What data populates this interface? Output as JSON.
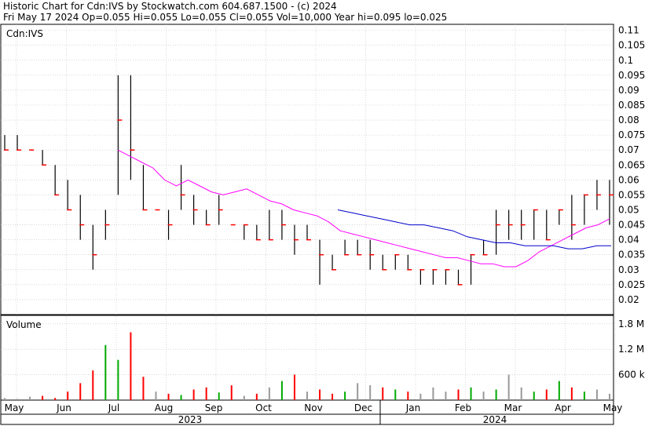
{
  "header": {
    "line1": "Historic Chart for Cdn:IVS by Stockwatch.com 604.687.1500 - (c) 2024",
    "line2": "Fri May 17 2024  Op=0.055  Hi=0.055  Lo=0.055  Cl=0.055  Vol=10,000  Year hi=0.095  lo=0.025"
  },
  "price_panel": {
    "label": "Cdn:IVS",
    "y_ticks": [
      "0.11",
      "0.105",
      "0.1",
      "0.095",
      "0.09",
      "0.085",
      "0.08",
      "0.075",
      "0.07",
      "0.065",
      "0.06",
      "0.055",
      "0.05",
      "0.045",
      "0.04",
      "0.035",
      "0.03",
      "0.025",
      "0.02"
    ]
  },
  "volume_panel": {
    "label": "Volume",
    "y_ticks": [
      "1.8 M",
      "1.2 M",
      "600 k"
    ]
  },
  "x_axis": {
    "months": [
      "May",
      "Jun",
      "Jul",
      "Aug",
      "Sep",
      "Oct",
      "Nov",
      "Dec",
      "Jan",
      "Feb",
      "Mar",
      "Apr",
      "May"
    ],
    "years": [
      "2023",
      "2024"
    ]
  },
  "colors": {
    "bar_up": "#000000",
    "close_tick": "#ff0000",
    "ma_short": "#ff00ff",
    "ma_long": "#0000cc",
    "vol_up": "#00aa00",
    "vol_down": "#ff0000",
    "vol_flat": "#999999",
    "grid": "#c0c0c0"
  },
  "chart_data": [
    {
      "type": "ohlc",
      "title": "Cdn:IVS",
      "ylim": [
        0.015,
        0.112
      ],
      "grid": true,
      "months": [
        "May",
        "Jun",
        "Jul",
        "Aug",
        "Sep",
        "Oct",
        "Nov",
        "Dec",
        "Jan",
        "Feb",
        "Mar",
        "Apr",
        "May"
      ],
      "weeks_hl_close": [
        [
          0.075,
          0.07,
          0.07
        ],
        [
          0.075,
          0.07,
          0.07
        ],
        [
          0.07,
          0.07,
          0.07
        ],
        [
          0.07,
          0.065,
          0.065
        ],
        [
          0.065,
          0.055,
          0.055
        ],
        [
          0.06,
          0.05,
          0.05
        ],
        [
          0.055,
          0.04,
          0.045
        ],
        [
          0.045,
          0.03,
          0.035
        ],
        [
          0.05,
          0.04,
          0.045
        ],
        [
          0.095,
          0.055,
          0.08
        ],
        [
          0.095,
          0.06,
          0.07
        ],
        [
          0.065,
          0.05,
          0.05
        ],
        [
          0.05,
          0.05,
          0.05
        ],
        [
          0.05,
          0.04,
          0.045
        ],
        [
          0.065,
          0.05,
          0.055
        ],
        [
          0.055,
          0.045,
          0.05
        ],
        [
          0.05,
          0.045,
          0.045
        ],
        [
          0.055,
          0.045,
          0.05
        ],
        [
          0.045,
          0.045,
          0.045
        ],
        [
          0.045,
          0.04,
          0.045
        ],
        [
          0.045,
          0.04,
          0.04
        ],
        [
          0.05,
          0.04,
          0.04
        ],
        [
          0.05,
          0.04,
          0.045
        ],
        [
          0.045,
          0.035,
          0.04
        ],
        [
          0.045,
          0.04,
          0.04
        ],
        [
          0.04,
          0.025,
          0.035
        ],
        [
          0.035,
          0.03,
          0.03
        ],
        [
          0.04,
          0.035,
          0.035
        ],
        [
          0.04,
          0.035,
          0.035
        ],
        [
          0.04,
          0.03,
          0.035
        ],
        [
          0.035,
          0.03,
          0.03
        ],
        [
          0.035,
          0.03,
          0.035
        ],
        [
          0.035,
          0.03,
          0.03
        ],
        [
          0.03,
          0.025,
          0.03
        ],
        [
          0.03,
          0.025,
          0.03
        ],
        [
          0.03,
          0.025,
          0.03
        ],
        [
          0.03,
          0.025,
          0.025
        ],
        [
          0.035,
          0.025,
          0.035
        ],
        [
          0.04,
          0.035,
          0.035
        ],
        [
          0.05,
          0.035,
          0.045
        ],
        [
          0.05,
          0.04,
          0.045
        ],
        [
          0.05,
          0.04,
          0.045
        ],
        [
          0.05,
          0.04,
          0.05
        ],
        [
          0.05,
          0.04,
          0.04
        ],
        [
          0.05,
          0.045,
          0.05
        ],
        [
          0.055,
          0.04,
          0.045
        ],
        [
          0.055,
          0.045,
          0.055
        ],
        [
          0.06,
          0.05,
          0.055
        ],
        [
          0.06,
          0.045,
          0.055
        ]
      ],
      "ma_short": [
        0.07,
        0.068,
        0.066,
        0.064,
        0.06,
        0.058,
        0.06,
        0.058,
        0.056,
        0.055,
        0.056,
        0.057,
        0.055,
        0.053,
        0.052,
        0.05,
        0.049,
        0.048,
        0.046,
        0.043,
        0.042,
        0.041,
        0.04,
        0.039,
        0.038,
        0.037,
        0.036,
        0.035,
        0.034,
        0.034,
        0.033,
        0.032,
        0.032,
        0.031,
        0.031,
        0.033,
        0.036,
        0.038,
        0.04,
        0.042,
        0.044,
        0.045,
        0.047
      ],
      "ma_long": [
        0.05,
        0.049,
        0.048,
        0.047,
        0.046,
        0.045,
        0.045,
        0.044,
        0.043,
        0.041,
        0.04,
        0.039,
        0.039,
        0.038,
        0.038,
        0.038,
        0.037,
        0.037,
        0.038,
        0.038
      ],
      "volume": [
        5,
        3,
        8,
        10,
        5,
        20,
        40,
        70,
        130,
        95,
        160,
        55,
        20,
        15,
        12,
        25,
        30,
        18,
        35,
        10,
        15,
        30,
        45,
        60,
        20,
        25,
        15,
        20,
        40,
        35,
        30,
        25,
        20,
        15,
        30,
        20,
        25,
        30,
        20,
        25,
        60,
        30,
        20,
        25,
        45,
        30,
        20,
        25,
        15
      ]
    }
  ]
}
